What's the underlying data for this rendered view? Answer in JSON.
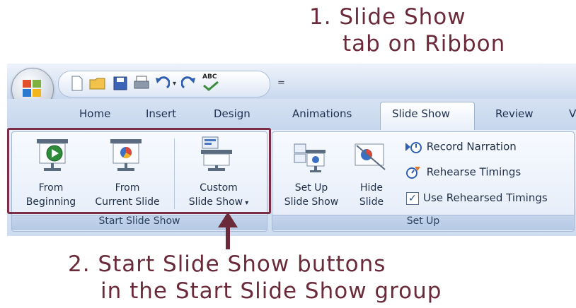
{
  "annotations": {
    "step1_line1": "1. Slide Show",
    "step1_line2": "tab on Ribbon",
    "step2_line1": "2. Start Slide Show buttons",
    "step2_line2": "in the Start Slide Show group"
  },
  "quick_access": {
    "icons": [
      "new-icon",
      "open-icon",
      "save-icon",
      "print-icon",
      "undo-icon",
      "dropdown-icon",
      "redo-icon",
      "spelling-icon"
    ],
    "customize_symbol": "=",
    "spell_text": "ABC"
  },
  "tabs": [
    {
      "label": "Home"
    },
    {
      "label": "Insert"
    },
    {
      "label": "Design"
    },
    {
      "label": "Animations"
    },
    {
      "label": "Slide Show"
    },
    {
      "label": "Review"
    },
    {
      "label": "V"
    }
  ],
  "active_tab": "Slide Show",
  "groups": {
    "start": {
      "label": "Start Slide Show",
      "from_beginning": {
        "line1": "From",
        "line2": "Beginning"
      },
      "from_current": {
        "line1": "From",
        "line2": "Current Slide"
      },
      "custom": {
        "line1": "Custom",
        "line2": "Slide Show"
      }
    },
    "setup": {
      "label": "Set Up",
      "setup_show": {
        "line1": "Set Up",
        "line2": "Slide Show"
      },
      "hide_slide": {
        "line1": "Hide",
        "line2": "Slide"
      },
      "record_narration": "Record Narration",
      "rehearse_timings": "Rehearse Timings",
      "use_rehearsed": "Use Rehearsed Timings",
      "use_rehearsed_checked": true
    }
  },
  "colors": {
    "annotation": "#6b2a3a",
    "highlight_box": "#7b2e45"
  }
}
